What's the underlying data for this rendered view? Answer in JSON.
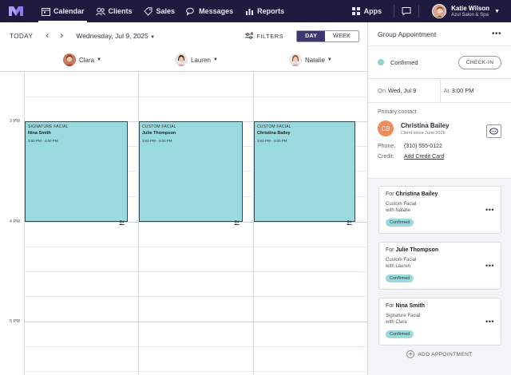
{
  "nav": {
    "items": [
      {
        "label": "Calendar",
        "icon": "calendar-icon"
      },
      {
        "label": "Clients",
        "icon": "clients-icon"
      },
      {
        "label": "Sales",
        "icon": "tag-icon"
      },
      {
        "label": "Messages",
        "icon": "chat-bubbles-icon"
      },
      {
        "label": "Reports",
        "icon": "bar-chart-icon"
      }
    ],
    "apps_label": "Apps",
    "user_name": "Katie Wilson",
    "user_business": "Azul Salon & Spa"
  },
  "toolbar": {
    "today": "TODAY",
    "prev": "‹",
    "next": "›",
    "date": "Wednesday, Jul 9, 2025",
    "filters": "FILTERS",
    "view_day": "DAY",
    "view_week": "WEEK"
  },
  "staff": [
    "Clara",
    "Lauren",
    "Natalie"
  ],
  "times": [
    "3 PM",
    "4 PM",
    "5 PM"
  ],
  "appointments": [
    {
      "service": "SIGNATURE FACIAL",
      "client": "Nina Smith",
      "time": "3:00 PM - 4:00 PM"
    },
    {
      "service": "CUSTOM FACIAL",
      "client": "Julie Thompson",
      "time": "3:00 PM - 4:00 PM"
    },
    {
      "service": "CUSTOM FACIAL",
      "client": "Christina Bailey",
      "time": "3:00 PM - 4:00 PM"
    }
  ],
  "panel": {
    "title": "Group Appointment",
    "more": "•••",
    "status": "Confirmed",
    "checkin": "CHECK-IN",
    "on_label": "On",
    "on_value": "Wed, Jul 9",
    "at_label": "At",
    "at_value": "3:00 PM",
    "primary_label": "Primary contact",
    "contact_initials": "CB",
    "contact_name": "Christina Bailey",
    "contact_since": "Client since June 2025",
    "phone_label": "Phone:",
    "phone_value": "(310) 555-0122",
    "credit_label": "Credit:",
    "credit_value": "Add Credit Card",
    "cards": [
      {
        "for": "For",
        "name": "Christina Bailey",
        "service": "Custom Facial",
        "with": "with Natalie",
        "status": "Confirmed"
      },
      {
        "for": "For",
        "name": "Julie Thompson",
        "service": "Custom Facial",
        "with": "with Lauren",
        "status": "Confirmed"
      },
      {
        "for": "For",
        "name": "Nina Smith",
        "service": "Signature Facial",
        "with": "with Clara",
        "status": "Confirmed"
      }
    ],
    "add_label": "ADD APPOINTMENT"
  },
  "colors": {
    "nav_bg": "#1e1b3f",
    "appt_fill": "#9ad9dd",
    "contact_avatar": "#f08a5a",
    "toggle_active": "#3b3870"
  }
}
